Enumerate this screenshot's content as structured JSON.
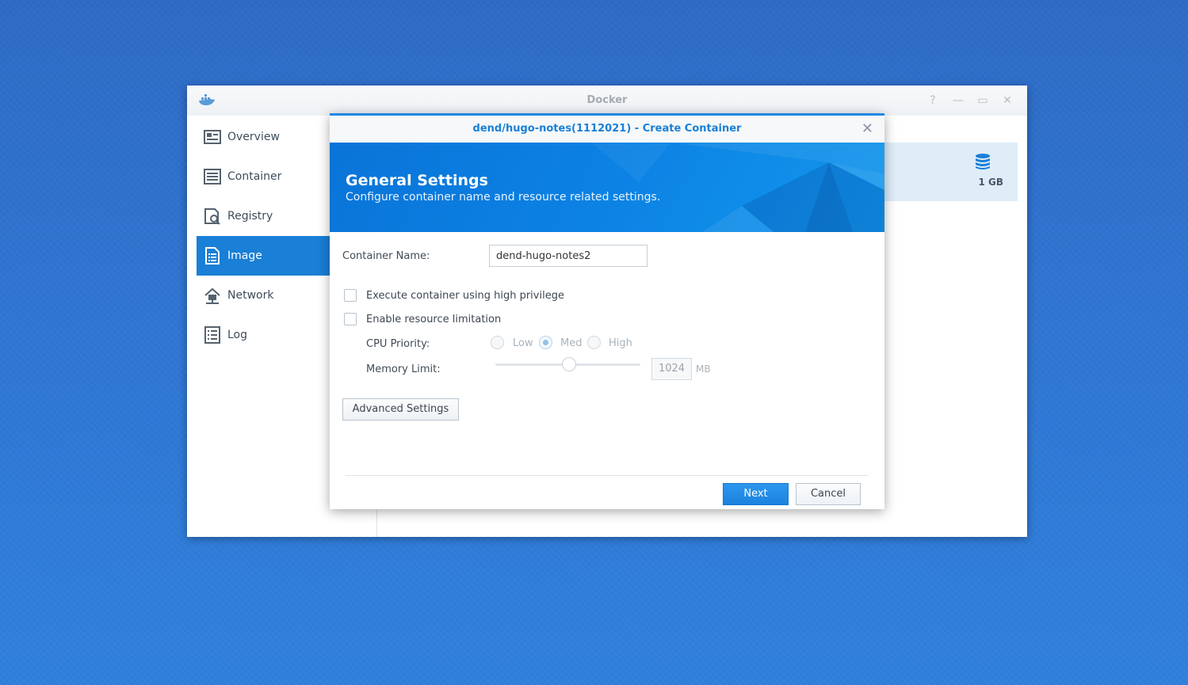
{
  "app": {
    "title": "Docker",
    "controls": [
      "help-icon",
      "minimize-icon",
      "maximize-icon",
      "close-icon"
    ]
  },
  "sidebar": {
    "items": [
      {
        "label": "Overview",
        "icon": "overview-icon",
        "active": false
      },
      {
        "label": "Container",
        "icon": "container-icon",
        "active": false
      },
      {
        "label": "Registry",
        "icon": "registry-icon",
        "active": false
      },
      {
        "label": "Image",
        "icon": "image-icon",
        "active": true
      },
      {
        "label": "Network",
        "icon": "network-icon",
        "active": false
      },
      {
        "label": "Log",
        "icon": "log-icon",
        "active": false
      }
    ]
  },
  "image_list": {
    "size": "1 GB"
  },
  "dialog": {
    "title": "dend/hugo-notes(1112021) - Create Container",
    "banner_title": "General Settings",
    "banner_subtitle": "Configure container name and resource related settings.",
    "container_name_label": "Container Name:",
    "container_name_value": "dend-hugo-notes2",
    "high_privilege_label": "Execute container using high privilege",
    "resource_limit_label": "Enable resource limitation",
    "cpu_priority_label": "CPU Priority:",
    "cpu_options": [
      "Low",
      "Med",
      "High"
    ],
    "cpu_selected": "Med",
    "memory_limit_label": "Memory Limit:",
    "memory_value": "1024",
    "memory_unit": "MB",
    "memory_slider_fraction": 0.5,
    "advanced_button": "Advanced Settings",
    "next_button": "Next",
    "cancel_button": "Cancel"
  },
  "colors": {
    "accent": "#1a7fd6",
    "desktop": "#2f75d2"
  }
}
